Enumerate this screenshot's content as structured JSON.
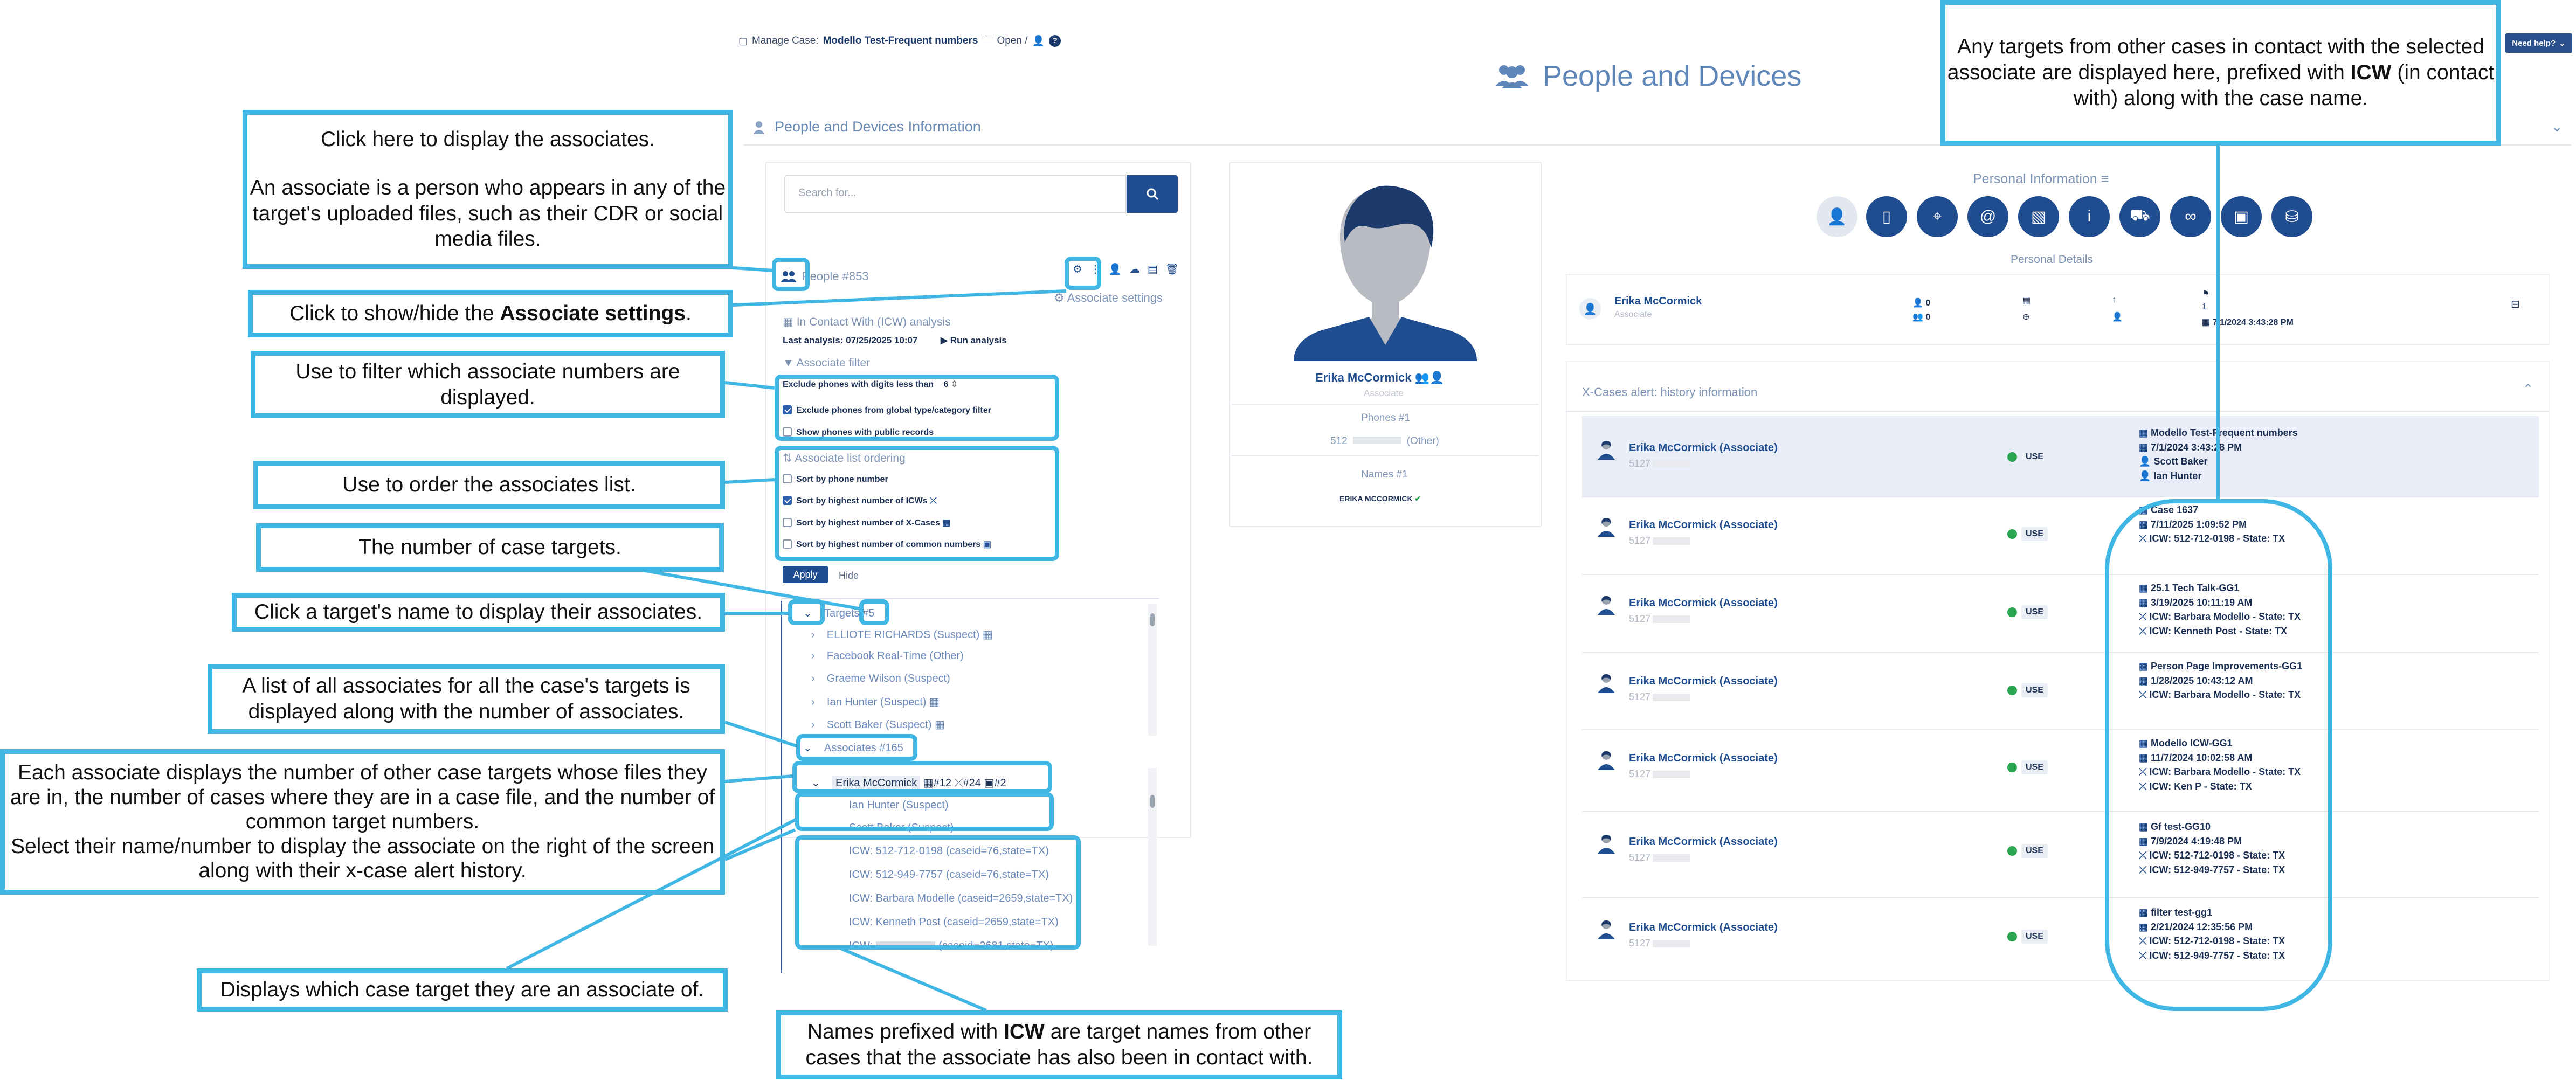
{
  "breadcrumb": {
    "prefix": "Manage Case:",
    "case_name": "Modello Test-Frequent numbers",
    "status": "Open /"
  },
  "need_help": "Need help?",
  "page_title": "People and Devices",
  "section_header": "People and Devices Information",
  "search": {
    "placeholder": "Search for..."
  },
  "people": {
    "label": "People #853",
    "associate_settings": "Associate settings"
  },
  "icw": {
    "title": "In Contact With (ICW) analysis",
    "last_analysis": "Last analysis: 07/25/2025 10:07",
    "run": "Run analysis"
  },
  "filter": {
    "title": "Associate filter",
    "exclude_digits_label": "Exclude phones with digits less than",
    "exclude_digits_value": "6",
    "opt1": "Exclude phones from global type/category filter",
    "opt2": "Show phones with public records"
  },
  "ordering": {
    "title": "Associate list ordering",
    "opt1": "Sort by phone number",
    "opt2": "Sort by highest number of ICWs",
    "opt3": "Sort by highest number of X-Cases",
    "opt4": "Sort by highest number of common numbers"
  },
  "buttons": {
    "apply": "Apply",
    "hide": "Hide"
  },
  "targets": {
    "label": "Targets #5",
    "items": [
      "ELLIOTE RICHARDS (Suspect)",
      "Facebook Real-Time (Other)",
      "Graeme Wilson (Suspect)",
      "Ian Hunter (Suspect)",
      "Scott Baker (Suspect)"
    ]
  },
  "associates": {
    "label": "Associates #165",
    "first": {
      "name": "Erika McCormick",
      "c1": "#12",
      "c2": "#24",
      "c3": "#2"
    },
    "sub": [
      "Ian Hunter (Suspect)",
      "Scott Baker (Suspect)"
    ],
    "icw": [
      "ICW: 512-712-0198 (caseid=76,state=TX)",
      "ICW: 512-949-7757 (caseid=76,state=TX)",
      "ICW: Barbara Modelle (caseid=2659,state=TX)",
      "ICW: Kenneth Post (caseid=2659,state=TX)",
      "ICW:",
      "(caseid=2681,state=TX)"
    ]
  },
  "profile": {
    "name": "Erika McCormick",
    "role": "Associate",
    "phones_label": "Phones #1",
    "phone": "512",
    "phone_type": "(Other)",
    "names_label": "Names #1",
    "name_upper": "ERIKA MCCORMICK"
  },
  "personal": {
    "title": "Personal Information",
    "details_title": "Personal Details",
    "name": "Erika McCormick",
    "role": "Associate",
    "count1": "0",
    "count2": "0",
    "count3": "1",
    "date": "7/1/2024 3:43:28 PM"
  },
  "xcases": {
    "title": "X-Cases alert: history information",
    "use": "USE",
    "rows": [
      {
        "name": "Erika McCormick (Associate)",
        "sub": "5127",
        "lines": [
          "Modello Test-Frequent numbers",
          "7/1/2024 3:43:28 PM",
          "Scott Baker",
          "Ian Hunter"
        ]
      },
      {
        "name": "Erika McCormick (Associate)",
        "sub": "5127",
        "lines": [
          "Case 1637",
          "7/11/2025 1:09:52 PM",
          "ICW: 512-712-0198 - State: TX"
        ]
      },
      {
        "name": "Erika McCormick (Associate)",
        "sub": "5127",
        "lines": [
          "25.1 Tech Talk-GG1",
          "3/19/2025 10:11:19 AM",
          "ICW: Barbara Modello - State: TX",
          "ICW: Kenneth Post - State: TX"
        ]
      },
      {
        "name": "Erika McCormick (Associate)",
        "sub": "5127",
        "lines": [
          "Person Page Improvements-GG1",
          "1/28/2025 10:43:12 AM",
          "ICW: Barbara Modello - State: TX"
        ]
      },
      {
        "name": "Erika McCormick (Associate)",
        "sub": "5127",
        "lines": [
          "Modello ICW-GG1",
          "11/7/2024 10:02:58 AM",
          "ICW: Barbara Modello - State: TX",
          "ICW: Ken P - State: TX"
        ]
      },
      {
        "name": "Erika McCormick (Associate)",
        "sub": "5127",
        "lines": [
          "Gf test-GG10",
          "7/9/2024 4:19:48 PM",
          "ICW: 512-712-0198 - State: TX",
          "ICW: 512-949-7757 - State: TX"
        ]
      },
      {
        "name": "Erika McCormick (Associate)",
        "sub": "5127",
        "lines": [
          "filter test-gg1",
          "2/21/2024 12:35:56 PM",
          "ICW: 512-712-0198 - State: TX",
          "ICW: 512-949-7757 - State: TX"
        ]
      }
    ]
  },
  "annotations": {
    "a1_l1": "Click here to display the associates.",
    "a1_l2": "An associate is a person who appears in any of the target's uploaded files, such as their CDR or social media files.",
    "a2_pre": "Click to show/hide the",
    "a2_bold": "Associate settings",
    "a2_post": ".",
    "a3": "Use to filter which associate numbers are displayed.",
    "a4": "Use to order the associates list.",
    "a5": "The number of case targets.",
    "a6": "Click a target's name to display their associates.",
    "a7": "A list of all associates for all the case's targets is displayed along with the number of associates.",
    "a8_l1": "Each associate displays the number of other case targets whose files they are in, the number of cases where they are in a case file, and the number of common target numbers.",
    "a8_l2": "Select their name/number to display the associate on the right of the screen along with their x-case alert history.",
    "a9": "Displays which case target they are an associate of.",
    "a10_pre": "Names prefixed with",
    "a10_bold": "ICW",
    "a10_post": "are target names from other cases that the associate has also been in contact with.",
    "a11_pre": "Any targets from other cases in contact with the selected associate are displayed here, prefixed with",
    "a11_bold": "ICW",
    "a11_post": "(in contact with) along with the case name."
  }
}
